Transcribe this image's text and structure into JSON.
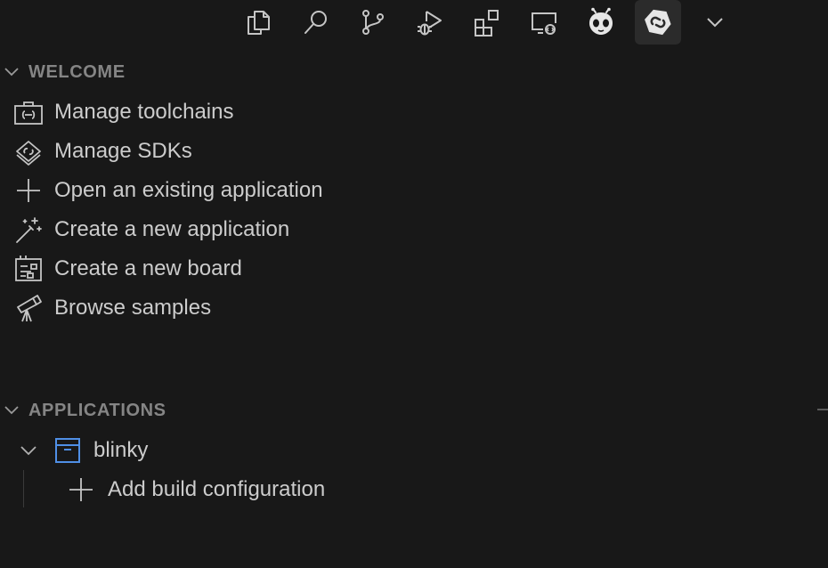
{
  "activity_bar": {
    "items": [
      {
        "icon": "explorer-icon"
      },
      {
        "icon": "search-icon"
      },
      {
        "icon": "source-control-icon"
      },
      {
        "icon": "run-and-debug-icon"
      },
      {
        "icon": "extensions-icon"
      },
      {
        "icon": "remote-explorer-icon"
      },
      {
        "icon": "platformio-alien-icon"
      },
      {
        "icon": "nrf-connect-icon",
        "active": true
      },
      {
        "icon": "chevron-down-icon"
      }
    ]
  },
  "welcome": {
    "title": "WELCOME",
    "items": [
      {
        "label": "Manage toolchains",
        "icon": "toolchain-icon"
      },
      {
        "label": "Manage SDKs",
        "icon": "sdk-icon"
      },
      {
        "label": "Open an existing application",
        "icon": "plus-icon"
      },
      {
        "label": "Create a new application",
        "icon": "magic-wand-icon"
      },
      {
        "label": "Create a new board",
        "icon": "board-icon"
      },
      {
        "label": "Browse samples",
        "icon": "telescope-icon"
      }
    ]
  },
  "applications": {
    "title": "APPLICATIONS",
    "apps": [
      {
        "name": "blinky",
        "icon": "application-box-icon",
        "children": [
          {
            "label": "Add build configuration",
            "icon": "plus-icon"
          }
        ]
      }
    ]
  },
  "colors": {
    "background": "#181818",
    "text": "#cccccc",
    "section_header": "#858585",
    "icon": "#c5c5c5",
    "app_icon_accent": "#4f8fe6"
  }
}
